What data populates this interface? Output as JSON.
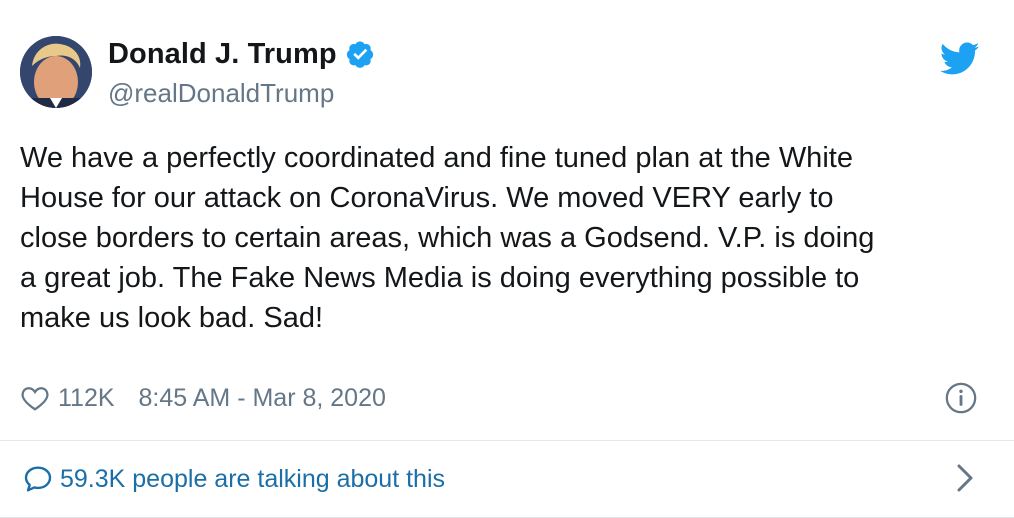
{
  "tweet": {
    "author": {
      "display_name": "Donald J. Trump",
      "handle": "@realDonaldTrump",
      "verified": true
    },
    "text": "We have a perfectly coordinated and fine tuned plan at the White\nHouse for our attack on CoronaVirus. We moved VERY early to\nclose borders to certain areas, which was a Godsend. V.P. is doing\na great job. The Fake News Media is doing everything possible to\nmake us look bad. Sad!",
    "likes": "112K",
    "timestamp": "8:45 AM - Mar 8, 2020",
    "talking": "59.3K people are talking about this"
  },
  "icons": {
    "brand": "twitter-bird-icon",
    "verified": "verified-badge-icon",
    "like": "heart-icon",
    "info": "info-icon",
    "reply": "speech-bubble-icon",
    "more": "chevron-right-icon"
  },
  "colors": {
    "twitter_blue": "#1da1f2",
    "link_blue": "#1b6fa8",
    "secondary_text": "#657786",
    "primary_text": "#14171a",
    "divider": "#e1e8ed"
  }
}
